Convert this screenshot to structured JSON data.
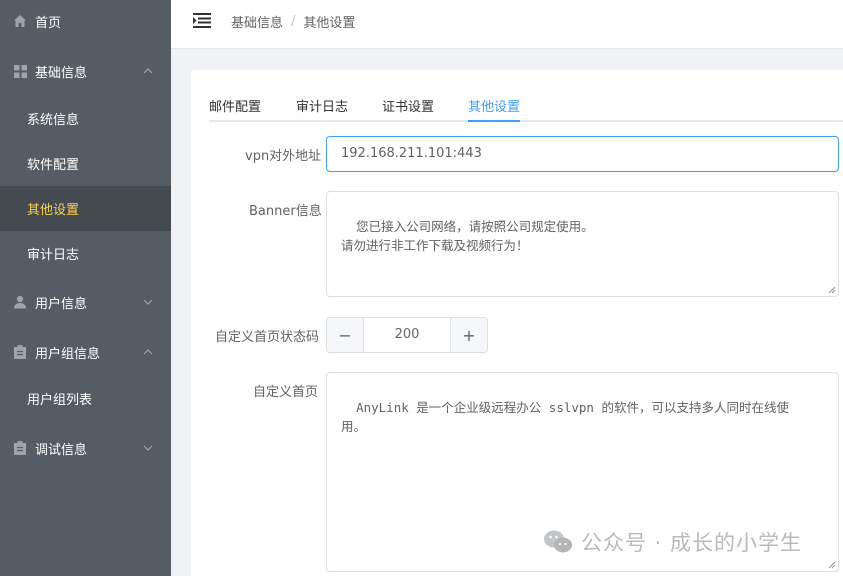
{
  "sidebar": {
    "items": [
      {
        "label": "首页",
        "icon": "home-icon"
      },
      {
        "label": "基础信息",
        "icon": "grid-icon",
        "expanded": true
      },
      {
        "label": "系统信息"
      },
      {
        "label": "软件配置"
      },
      {
        "label": "其他设置",
        "active": true
      },
      {
        "label": "审计日志"
      },
      {
        "label": "用户信息",
        "icon": "user-icon",
        "expanded": false
      },
      {
        "label": "用户组信息",
        "icon": "clipboard-icon",
        "expanded": true
      },
      {
        "label": "用户组列表"
      },
      {
        "label": "调试信息",
        "icon": "clipboard-icon",
        "expanded": false
      }
    ],
    "active_color": "#ffd04b",
    "bg_color": "#545c64"
  },
  "header": {
    "breadcrumb": [
      "基础信息",
      "其他设置"
    ],
    "separator": "/"
  },
  "tabs": [
    {
      "label": "邮件配置"
    },
    {
      "label": "审计日志"
    },
    {
      "label": "证书设置"
    },
    {
      "label": "其他设置",
      "active": true
    }
  ],
  "form": {
    "vpn_label": "vpn对外地址",
    "vpn_value": "192.168.211.101:443",
    "banner_label": "Banner信息",
    "banner_value": "您已接入公司网络，请按照公司规定使用。\n请勿进行非工作下载及视频行为！",
    "status_label": "自定义首页状态码",
    "status_value": "200",
    "minus": "−",
    "plus": "+",
    "homepage_label": "自定义首页",
    "homepage_value": "AnyLink 是一个企业级远程办公 sslvpn 的软件，可以支持多人同时在线使\n用。"
  },
  "watermark": "公众号 · 成长的小学生",
  "accent_color": "#409eff"
}
